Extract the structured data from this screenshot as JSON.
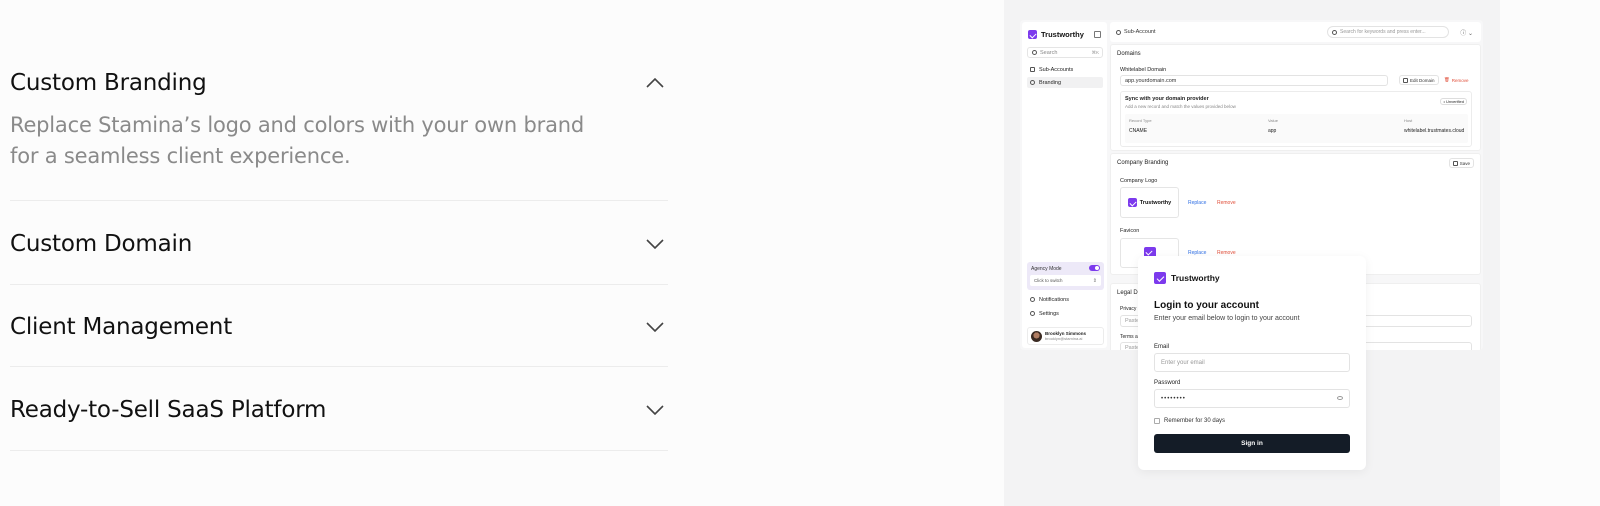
{
  "accordion": {
    "items": [
      {
        "title": "Custom Branding",
        "description": "Replace Stamina’s logo and colors with your own brand for a seamless client experience.",
        "expanded": true
      },
      {
        "title": "Custom Domain",
        "expanded": false
      },
      {
        "title": "Client Management",
        "expanded": false
      },
      {
        "title": "Ready-to-Sell SaaS Platform",
        "expanded": false
      }
    ]
  },
  "app": {
    "brand": "Trustworthy",
    "sidebar": {
      "search_placeholder": "Search",
      "search_shortcut": "⌘K",
      "items": [
        {
          "label": "Sub-Accounts",
          "active": false
        },
        {
          "label": "Branding",
          "active": true
        }
      ],
      "agency_mode_label": "Agency Mode",
      "switcher_label": "Click to switch",
      "bottom_items": [
        {
          "label": "Notifications"
        },
        {
          "label": "Settings"
        }
      ],
      "user": {
        "name": "Brooklyn Simmons",
        "email": "brooklyn@stamina.ai"
      }
    },
    "topbar": {
      "breadcrumb": "Sub-Account",
      "search_placeholder": "Search for keywords and press enter..."
    },
    "domains": {
      "title": "Domains",
      "whitelabel_label": "Whitelabel Domain",
      "domain_value": "app.yourdomain.com",
      "edit_label": "Edit Domain",
      "remove_label": "Remove",
      "sync_title": "Sync with your domain provider",
      "sync_desc": "Add a new record and match the values provided below",
      "sync_status": "• Unverified",
      "record_headers": [
        "Record Type",
        "Value",
        "Host"
      ],
      "record": [
        "CNAME",
        "app",
        "whitelabel.trustmates.cloud"
      ]
    },
    "company_branding": {
      "title": "Company Branding",
      "save_label": "Save",
      "logo_label": "Company Logo",
      "logo_text": "Trustworthy",
      "favicon_label": "Favicon",
      "replace_label": "Replace",
      "remove_label": "Remove"
    },
    "legal": {
      "title": "Legal D",
      "privacy_label": "Privacy P",
      "terms_label": "Terms ar",
      "paste_placeholder": "Paste"
    }
  },
  "login": {
    "brand": "Trustworthy",
    "heading": "Login to your account",
    "subheading": "Enter your email below to login to your account",
    "email_label": "Email",
    "email_placeholder": "Enter your email",
    "password_label": "Password",
    "password_value": "••••••••",
    "remember_label": "Remember for 30 days",
    "signin_label": "Sign in"
  },
  "colors": {
    "brand_purple": "#7c3aed",
    "signin_button": "#141c27",
    "remove_red": "#e04f3a",
    "replace_blue": "#2f6fe4"
  }
}
